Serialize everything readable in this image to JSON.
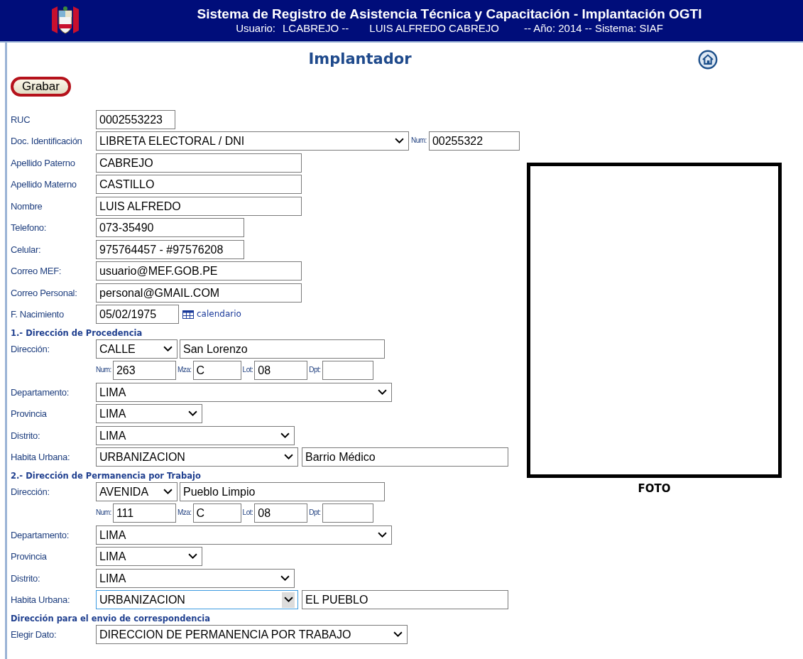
{
  "header": {
    "title": "Sistema de Registro de Asistencia Técnica y Capacitación - Implantación OGTI",
    "user_label": "Usuario:",
    "user_id": "LCABREJO --",
    "user_name": "LUIS ALFREDO CABREJO",
    "session": "-- Año: 2014 -- Sistema: SIAF"
  },
  "page_title": "Implantador",
  "save_button": {
    "label": "Grabar",
    "circled": true
  },
  "sections": [
    {
      "rows": [
        {
          "kind": "ruc",
          "label": "RUC",
          "controls": [
            {
              "kind": "input",
              "value": "0002553223"
            }
          ]
        },
        {
          "kind": "doc",
          "label": "Doc. Identificación",
          "controls": [
            {
              "kind": "select",
              "value": "LIBRETA ELECTORAL / DNI"
            },
            {
              "kind": "small-label",
              "value": "Num:"
            },
            {
              "kind": "input",
              "value": "00255322"
            }
          ]
        },
        {
          "kind": "name",
          "label": "Apellido Paterno",
          "controls": [
            {
              "kind": "input",
              "value": "CABREJO"
            }
          ]
        },
        {
          "kind": "name",
          "label": "Apellido Materno",
          "controls": [
            {
              "kind": "input",
              "value": "CASTILLO"
            }
          ]
        },
        {
          "kind": "name",
          "label": "Nombre",
          "controls": [
            {
              "kind": "input",
              "value": "LUIS ALFREDO"
            }
          ]
        },
        {
          "kind": "phone",
          "label": "Telefono:",
          "controls": [
            {
              "kind": "input",
              "value": "073-35490"
            }
          ]
        },
        {
          "kind": "phone",
          "label": "Celular:",
          "controls": [
            {
              "kind": "input",
              "value": "975764457 - #97576208"
            }
          ]
        },
        {
          "kind": "name",
          "label": "Correo MEF:",
          "controls": [
            {
              "kind": "input",
              "value": "usuario@MEF.GOB.PE"
            }
          ]
        },
        {
          "kind": "name",
          "label": "Correo Personal:",
          "controls": [
            {
              "kind": "input",
              "value": "personal@GMAIL.COM"
            }
          ]
        },
        {
          "kind": "date",
          "label": "F. Nacimiento",
          "controls": [
            {
              "kind": "input",
              "value": "05/02/1975"
            },
            {
              "kind": "link",
              "value": "calendario"
            }
          ]
        }
      ]
    },
    {
      "title": "1.- Dirección de Procedencia",
      "rows": [
        {
          "kind": "street",
          "label": "Dirección:",
          "controls": [
            {
              "kind": "select",
              "value": "CALLE"
            },
            {
              "kind": "input",
              "value": "San Lorenzo"
            }
          ]
        },
        {
          "kind": "numbers",
          "controls": [
            {
              "kind": "small-label",
              "value": "Num:"
            },
            {
              "kind": "input",
              "value": "263"
            },
            {
              "kind": "small-label",
              "value": "Mza:"
            },
            {
              "kind": "input",
              "value": "C"
            },
            {
              "kind": "small-label",
              "value": "Lot:"
            },
            {
              "kind": "input",
              "value": "08"
            },
            {
              "kind": "small-label",
              "value": "Dpt:"
            },
            {
              "kind": "input"
            }
          ]
        },
        {
          "kind": "dept",
          "label": "Departamento:",
          "controls": [
            {
              "kind": "select",
              "value": "LIMA"
            }
          ]
        },
        {
          "kind": "prov",
          "label": "Provincia",
          "controls": [
            {
              "kind": "select",
              "value": "LIMA"
            }
          ]
        },
        {
          "kind": "dist",
          "label": "Distrito:",
          "controls": [
            {
              "kind": "select",
              "value": "LIMA"
            }
          ]
        },
        {
          "kind": "urban",
          "label": "Habita Urbana:",
          "controls": [
            {
              "kind": "select",
              "value": "URBANIZACION",
              "focused": false
            },
            {
              "kind": "input",
              "value": "Barrio Médico"
            }
          ]
        }
      ]
    },
    {
      "title": "2.- Dirección de Permanencia por Trabajo",
      "rows": [
        {
          "kind": "street",
          "label": "Dirección:",
          "controls": [
            {
              "kind": "select",
              "value": "AVENIDA"
            },
            {
              "kind": "input",
              "value": "Pueblo Limpio"
            }
          ]
        },
        {
          "kind": "numbers",
          "controls": [
            {
              "kind": "small-label",
              "value": "Num:"
            },
            {
              "kind": "input",
              "value": "111"
            },
            {
              "kind": "small-label",
              "value": "Mza:"
            },
            {
              "kind": "input",
              "value": "C"
            },
            {
              "kind": "small-label",
              "value": "Lot:"
            },
            {
              "kind": "input",
              "value": "08"
            },
            {
              "kind": "small-label",
              "value": "Dpt:"
            },
            {
              "kind": "input"
            }
          ]
        },
        {
          "kind": "dept",
          "label": "Departamento:",
          "controls": [
            {
              "kind": "select",
              "value": "LIMA"
            }
          ]
        },
        {
          "kind": "prov",
          "label": "Provincia",
          "controls": [
            {
              "kind": "select",
              "value": "LIMA"
            }
          ]
        },
        {
          "kind": "dist",
          "label": "Distrito:",
          "controls": [
            {
              "kind": "select",
              "value": "LIMA"
            }
          ]
        },
        {
          "kind": "urban",
          "label": "Habita Urbana:",
          "controls": [
            {
              "kind": "select",
              "value": "URBANIZACION",
              "focused": true
            },
            {
              "kind": "input",
              "value": "EL PUEBLO"
            }
          ]
        }
      ]
    },
    {
      "title": "Dirección para el envio de correspondencia",
      "rows": [
        {
          "kind": "choice",
          "label": "Elegir Dato:",
          "controls": [
            {
              "kind": "select",
              "value": "DIRECCION DE PERMANENCIA POR TRABAJO"
            }
          ]
        }
      ]
    }
  ],
  "photo": {
    "caption": "FOTO"
  }
}
